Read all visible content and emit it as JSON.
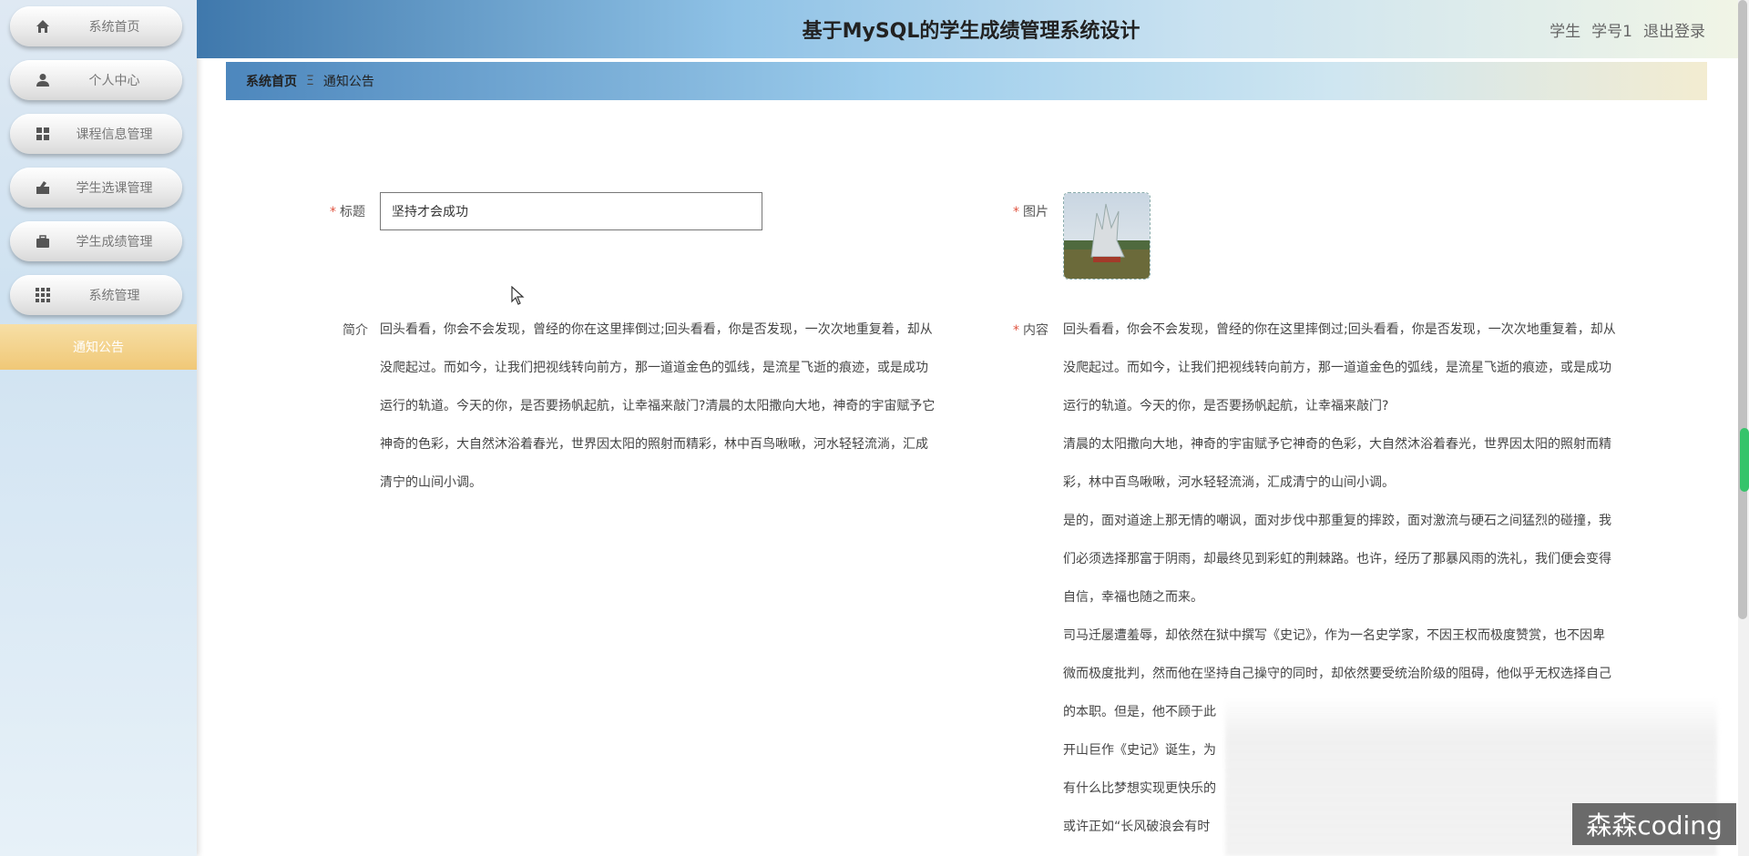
{
  "sidebar": {
    "items": [
      {
        "label": "系统首页",
        "icon": "home-icon"
      },
      {
        "label": "个人中心",
        "icon": "user-icon"
      },
      {
        "label": "课程信息管理",
        "icon": "grid-icon"
      },
      {
        "label": "学生选课管理",
        "icon": "course-select-icon"
      },
      {
        "label": "学生成绩管理",
        "icon": "briefcase-icon"
      },
      {
        "label": "系统管理",
        "icon": "apps-icon"
      }
    ],
    "active_item": "通知公告"
  },
  "header": {
    "title": "基于MySQL的学生成绩管理系统设计",
    "user_role": "学生",
    "user_name": "学号1",
    "logout": "退出登录"
  },
  "breadcrumb": {
    "home": "系统首页",
    "separator": "Ξ",
    "current": "通知公告"
  },
  "form": {
    "title_label": "标题",
    "title_value": "坚持才会成功",
    "image_label": "图片",
    "summary_label": "简介",
    "summary_lines": [
      "回头看看，你会不会发现，曾经的你在这里摔倒过;回头看看，你是否发现，一次次地重复着，却从",
      "没爬起过。而如今，让我们把视线转向前方，那一道道金色的弧线，是流星飞逝的痕迹，或是成功",
      "运行的轨道。今天的你，是否要扬帆起航，让幸福来敲门?清晨的太阳撒向大地，神奇的宇宙赋予它",
      "神奇的色彩，大自然沐浴着春光，世界因太阳的照射而精彩，林中百鸟啾啾，河水轻轻流淌，汇成",
      "清宁的山间小调。"
    ],
    "content_label": "内容",
    "content_lines": [
      "回头看看，你会不会发现，曾经的你在这里摔倒过;回头看看，你是否发现，一次次地重复着，却从",
      "没爬起过。而如今，让我们把视线转向前方，那一道道金色的弧线，是流星飞逝的痕迹，或是成功",
      "运行的轨道。今天的你，是否要扬帆起航，让幸福来敲门?",
      "清晨的太阳撒向大地，神奇的宇宙赋予它神奇的色彩，大自然沐浴着春光，世界因太阳的照射而精",
      "彩，林中百鸟啾啾，河水轻轻流淌，汇成清宁的山间小调。",
      "是的，面对道途上那无情的嘲讽，面对步伐中那重复的摔跤，面对激流与硬石之间猛烈的碰撞，我",
      "们必须选择那富于阴雨，却最终见到彩虹的荆棘路。也许，经历了那暴风雨的洗礼，我们便会变得",
      "自信，幸福也随之而来。",
      "司马迁屡遭羞辱，却依然在狱中撰写《史记》，作为一名史学家，不因王权而极度赞赏，也不因卑",
      "微而极度批判，然而他在坚持自己操守的同时，却依然要受统治阶级的阻碍，他似乎无权选择自己",
      "的本职。但是，他不顾于此",
      "开山巨作《史记》诞生，为",
      "有什么比梦想实现更快乐的",
      "或许正如“长风破浪会有时"
    ]
  },
  "watermark": "森森coding",
  "colors": {
    "required_star": "#e0533f",
    "active_menu": "#f0c877",
    "header_blue": "#3f78ac"
  }
}
